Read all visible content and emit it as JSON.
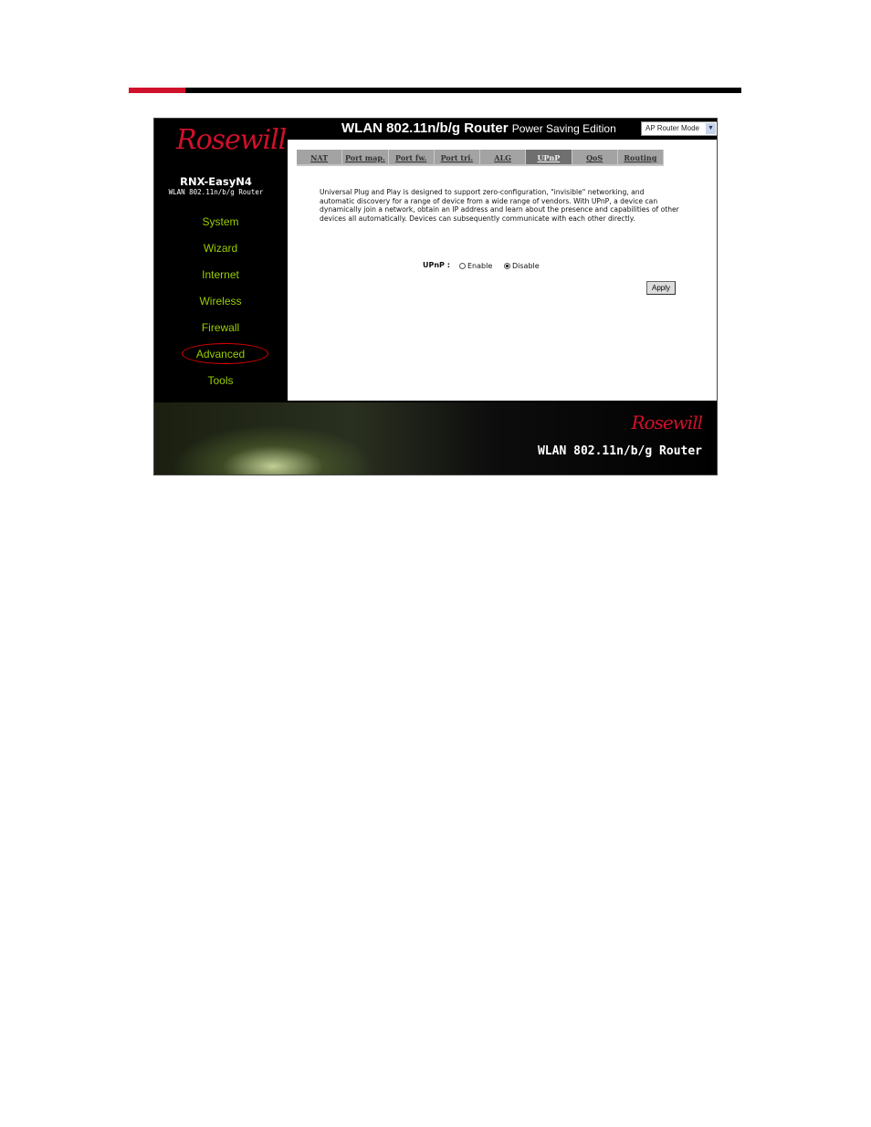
{
  "header": {
    "title": "WLAN 802.11n/b/g Router",
    "edition": "Power Saving Edition",
    "mode_select": "AP Router Mode"
  },
  "brand": {
    "logo": "Rosewill",
    "model": "RNX-EasyN4",
    "subtitle": "WLAN 802.11n/b/g Router"
  },
  "sidebar": {
    "items": [
      {
        "label": "System"
      },
      {
        "label": "Wizard"
      },
      {
        "label": "Internet"
      },
      {
        "label": "Wireless"
      },
      {
        "label": "Firewall"
      },
      {
        "label": "Advanced",
        "active": true
      },
      {
        "label": "Tools"
      }
    ]
  },
  "tabs": [
    {
      "label": "NAT"
    },
    {
      "label": "Port map."
    },
    {
      "label": "Port fw."
    },
    {
      "label": "Port tri."
    },
    {
      "label": "ALG"
    },
    {
      "label": "UPnP",
      "active": true
    },
    {
      "label": "QoS"
    },
    {
      "label": "Routing"
    }
  ],
  "main": {
    "description": "Universal Plug and Play is designed to support zero-configuration, \"invisible\" networking, and automatic discovery for a range of device from a wide range of vendors. With UPnP, a device can dynamically join a network, obtain an IP address and learn about the presence and capabilities of other devices all automatically. Devices can subsequently communicate with each other directly.",
    "upnp_label": "UPnP :",
    "enable_label": "Enable",
    "disable_label": "Disable",
    "selected": "Disable",
    "apply_label": "Apply"
  },
  "footer": {
    "logo": "Rosewill",
    "title": "WLAN 802.11n/b/g Router"
  },
  "colors": {
    "accent_red": "#d0112b",
    "nav_green": "#9acd00"
  }
}
